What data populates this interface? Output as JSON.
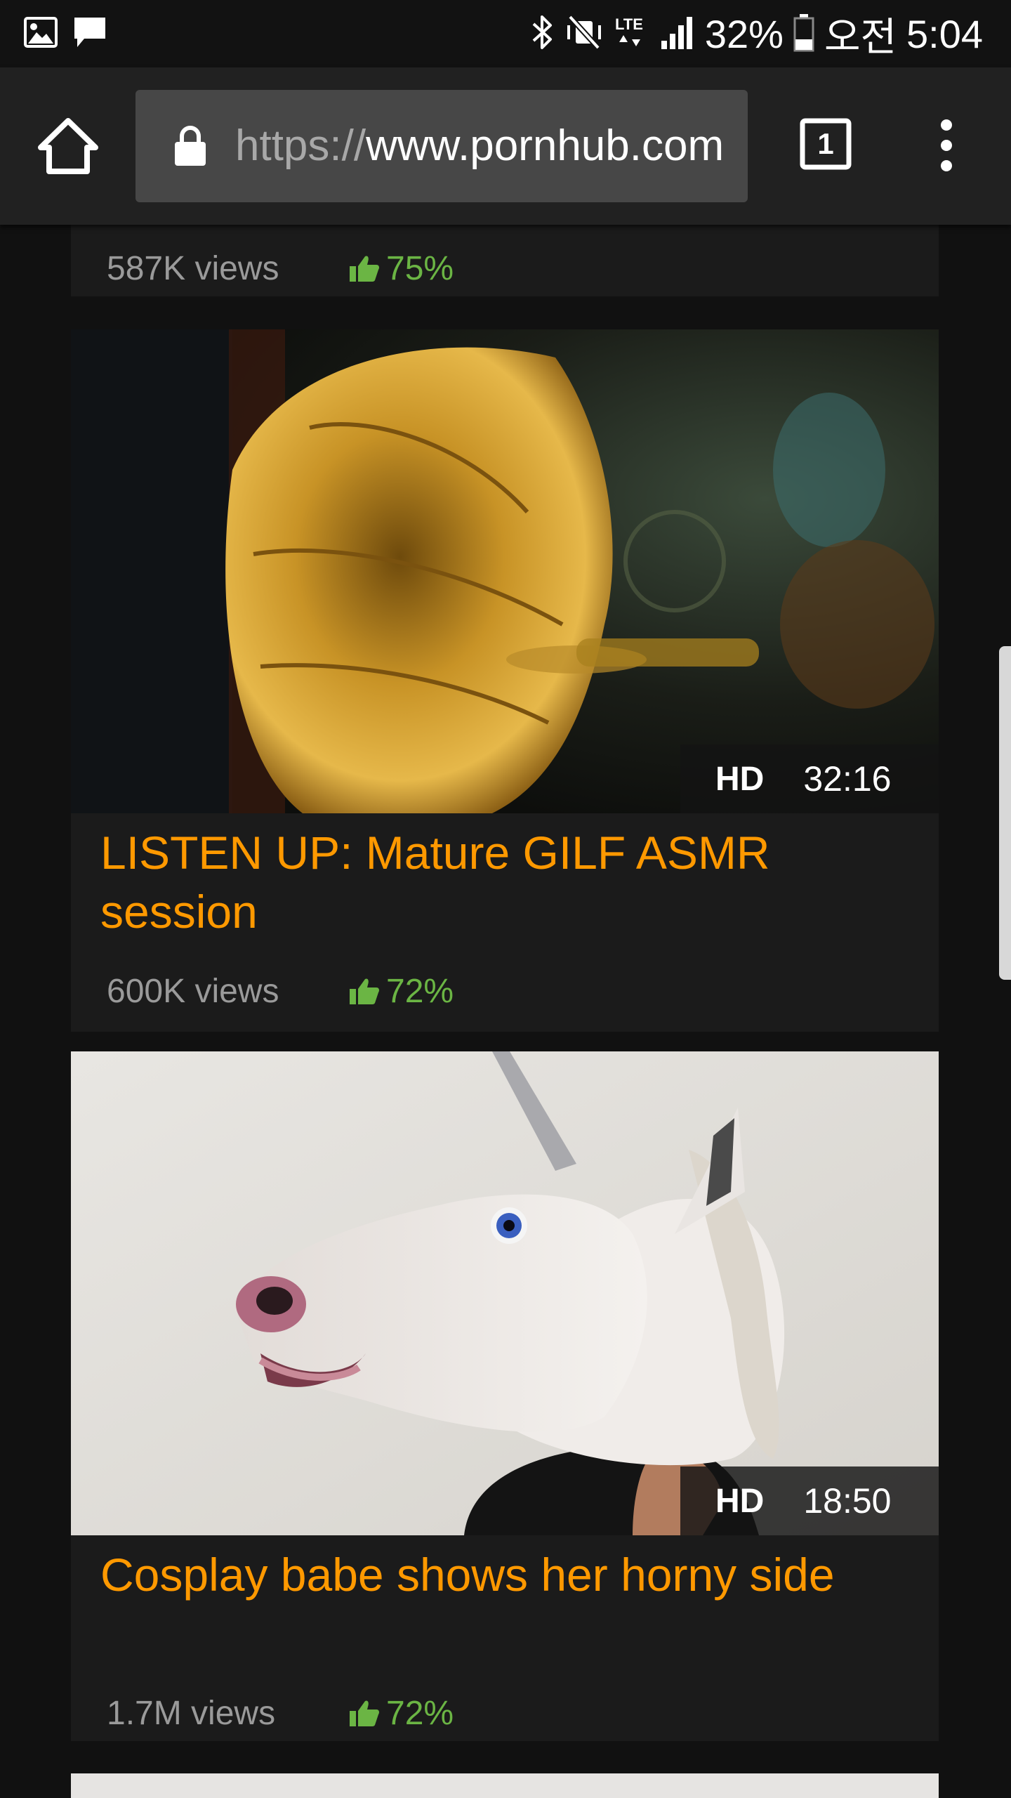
{
  "status_bar": {
    "battery": "32%",
    "ampm": "오전",
    "time": "5:04",
    "network": "LTE",
    "icons": [
      "gallery-icon",
      "message-icon",
      "bluetooth-icon",
      "vibrate-mute-icon",
      "lte-icon",
      "signal-icon",
      "battery-icon"
    ]
  },
  "browser": {
    "url_scheme": "https://",
    "url_host": "www.pornhub.com",
    "tab_count": "1"
  },
  "videos": [
    {
      "title": "",
      "views": "587K views",
      "rating": "75%"
    },
    {
      "title": "LISTEN UP: Mature GILF ASMR session",
      "views": "600K views",
      "rating": "72%",
      "quality": "HD",
      "duration": "32:16"
    },
    {
      "title": "Cosplay babe shows her horny side",
      "views": "1.7M views",
      "rating": "72%",
      "quality": "HD",
      "duration": "18:50"
    }
  ],
  "colors": {
    "accent": "#ff9900",
    "rating": "#6bb544",
    "background": "#111111",
    "card": "#1b1b1b",
    "toolbar": "#212121",
    "url_box": "#474747"
  }
}
